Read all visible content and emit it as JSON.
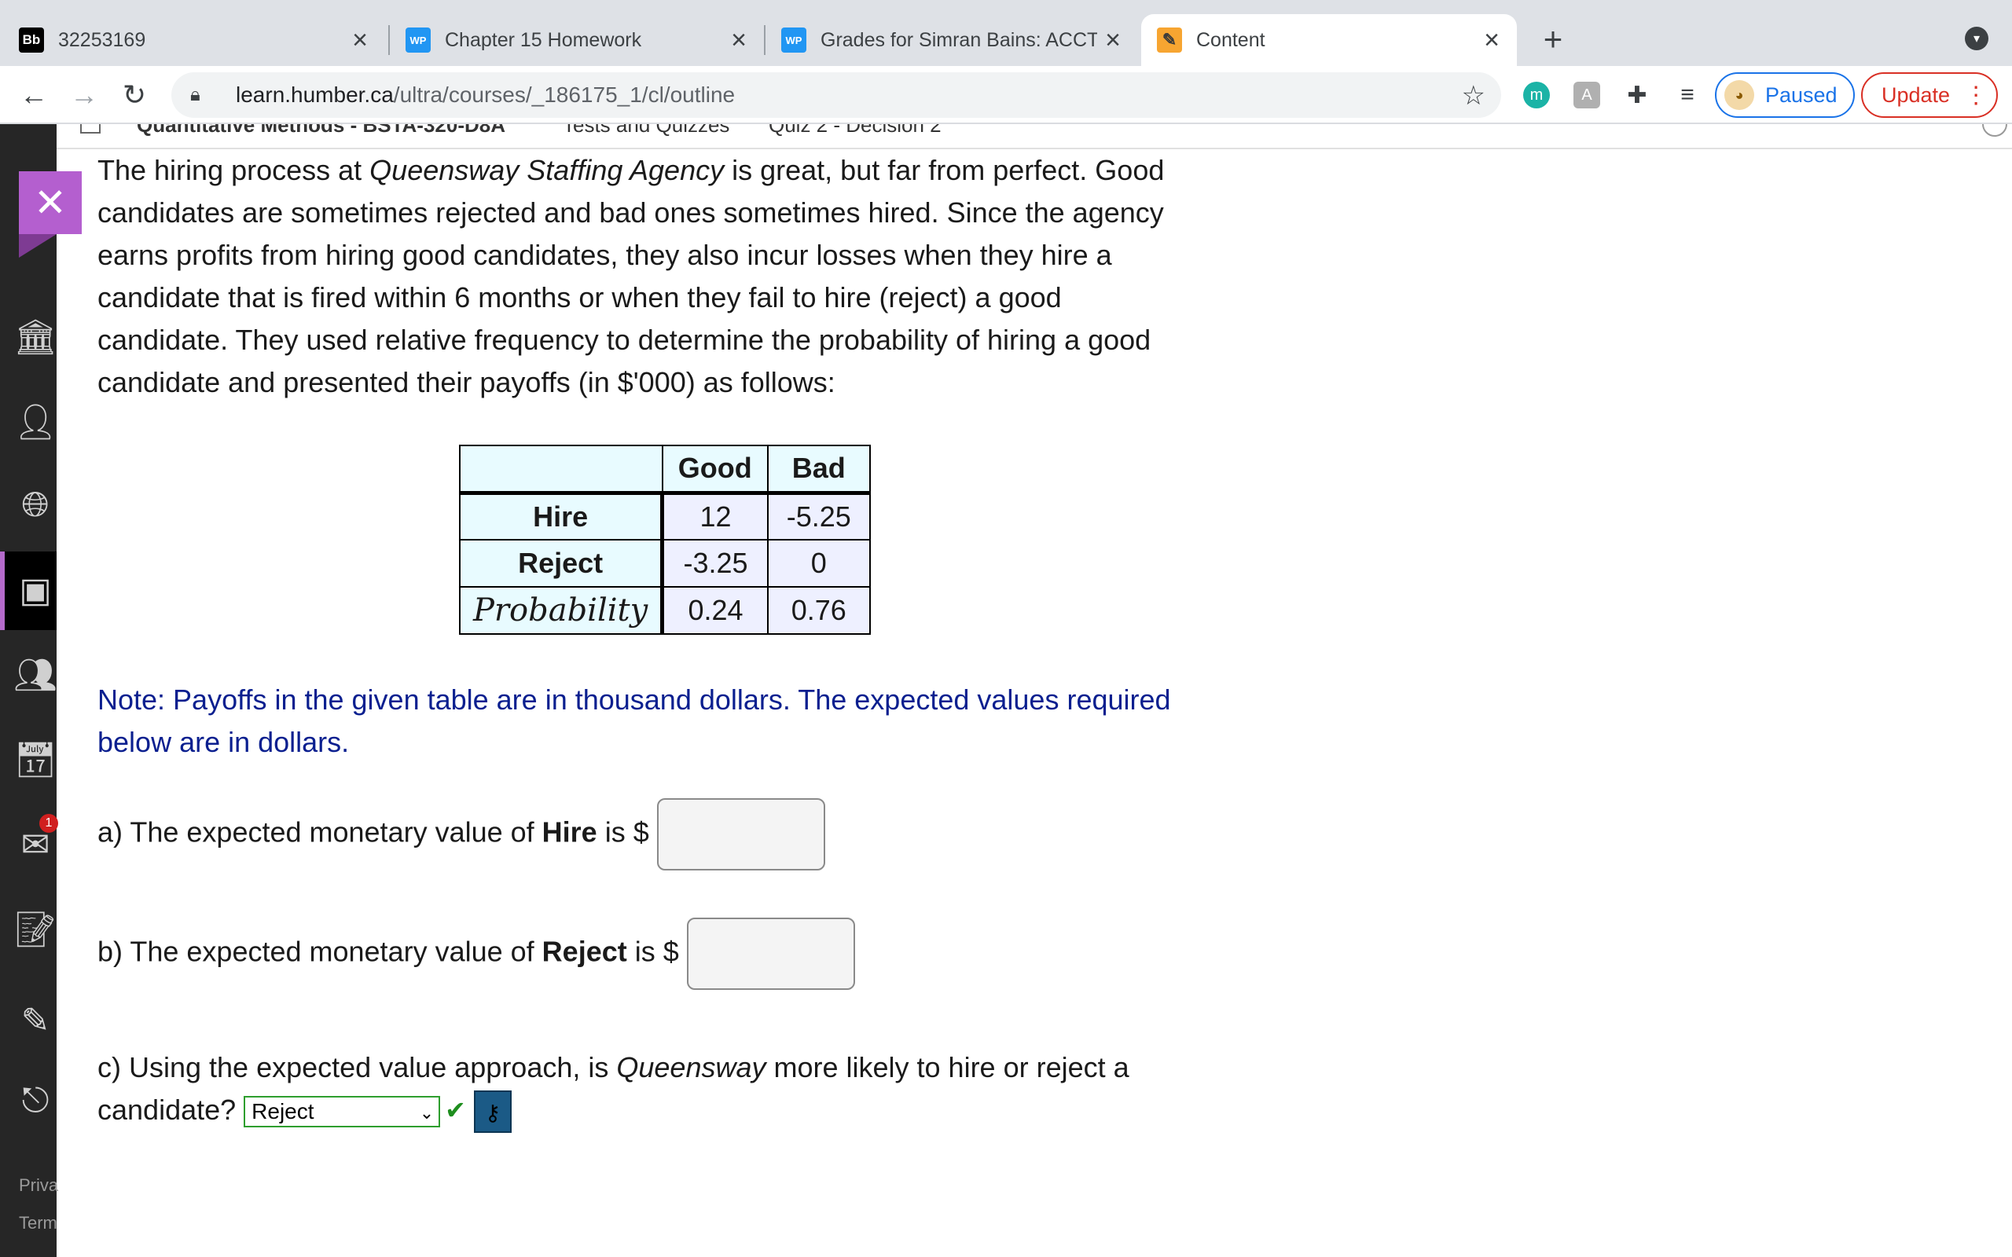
{
  "browser": {
    "tabs": [
      {
        "favicon": "Bb",
        "title": "32253169"
      },
      {
        "favicon": "WP",
        "title": "Chapter 15 Homework"
      },
      {
        "favicon": "WP",
        "title": "Grades for Simran Bains: ACCT"
      },
      {
        "favicon": "pencil",
        "title": "Content"
      }
    ],
    "url_host": "learn.humber.ca",
    "url_path": "/ultra/courses/_186175_1/cl/outline",
    "profile_status": "Paused",
    "update_label": "Update",
    "extension_m": "m"
  },
  "breadcrumb": {
    "course": "Quantitative Methods - BSTA-320-D8A",
    "section": "Tests and Quizzes",
    "item": "Quiz 2 - Decision 2"
  },
  "rail": {
    "badge": "1",
    "footer_privacy": "Priva",
    "footer_terms": "Term"
  },
  "question": {
    "intro_1": "The hiring process at ",
    "agency": "Queensway Staffing Agency",
    "intro_2": " is great, but far from perfect. Good candidates are sometimes rejected and bad ones sometimes hired. Since the agency earns profits from hiring good candidates, they also incur losses when they hire a candidate that is fired within 6 months or when they fail to hire (reject) a good candidate. They used relative frequency to determine the probability of hiring a good candidate and presented their payoffs (in $'000) as follows:",
    "table": {
      "headers": [
        "",
        "Good",
        "Bad"
      ],
      "rows": [
        {
          "label": "Hire",
          "good": "12",
          "bad": "-5.25"
        },
        {
          "label": "Reject",
          "good": "-3.25",
          "bad": "0"
        },
        {
          "label": "Probability",
          "good": "0.24",
          "bad": "0.76"
        }
      ]
    },
    "note": "Note: Payoffs in the given table are in thousand dollars. The expected values required below are in dollars.",
    "part_a_prefix": "a) The expected monetary value of ",
    "part_a_bold": "Hire",
    "part_a_suffix": " is $",
    "part_a_value": "",
    "part_b_prefix": "b) The expected monetary value of ",
    "part_b_bold": "Reject",
    "part_b_suffix": " is $",
    "part_b_value": "",
    "part_c_prefix": "c) Using the expected value approach, is ",
    "part_c_italic": "Queensway",
    "part_c_suffix": " more likely to hire or reject a",
    "part_c_line2": "candidate?",
    "part_c_selected": "Reject"
  }
}
